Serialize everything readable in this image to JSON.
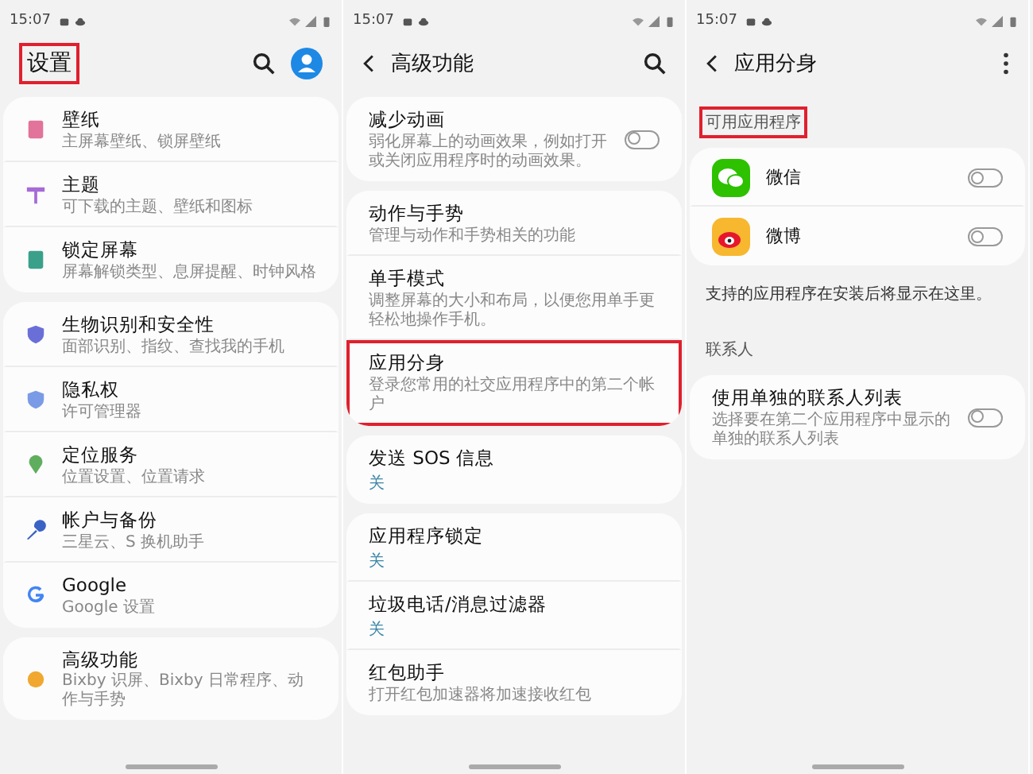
{
  "panels": [
    {
      "time": "15:07",
      "title": {
        "text": "设置",
        "highlighted": true
      },
      "back": false,
      "actions": [
        {
          "kind": "search"
        },
        {
          "kind": "avatar"
        }
      ],
      "groups": [
        {
          "kind": "card",
          "items": [
            {
              "kind": "entry",
              "title": "壁纸",
              "subtitle": "主屏幕壁纸、锁屏壁纸",
              "color": "#e2739a"
            },
            {
              "kind": "entry",
              "title": "主题",
              "subtitle": "可下载的主题、壁纸和图标",
              "color": "#a66bd6"
            },
            {
              "kind": "entry",
              "title": "锁定屏幕",
              "subtitle": "屏幕解锁类型、息屏提醒、时钟风格",
              "color": "#3aa08a"
            }
          ]
        },
        {
          "kind": "card",
          "items": [
            {
              "kind": "entry",
              "title": "生物识别和安全性",
              "subtitle": "面部识别、指纹、查找我的手机",
              "color": "#6a6fd8"
            },
            {
              "kind": "entry",
              "title": "隐私权",
              "subtitle": "许可管理器",
              "color": "#7a9be6"
            },
            {
              "kind": "entry",
              "title": "定位服务",
              "subtitle": "位置设置、位置请求",
              "color": "#5fae5f"
            },
            {
              "kind": "entry",
              "title": "帐户与备份",
              "subtitle": "三星云、S 换机助手",
              "color": "#3b62c5"
            },
            {
              "kind": "entry",
              "title": "Google",
              "subtitle": "Google 设置",
              "color": "#4285f4"
            }
          ]
        },
        {
          "kind": "card",
          "items": [
            {
              "kind": "entry",
              "title": "高级功能",
              "subtitle": "Bixby 识屏、Bixby 日常程序、动作与手势",
              "color": "#f0a830"
            }
          ]
        }
      ]
    },
    {
      "time": "15:07",
      "title": {
        "text": "高级功能",
        "highlighted": false
      },
      "back": true,
      "actions": [
        {
          "kind": "search"
        }
      ],
      "groups": [
        {
          "kind": "card",
          "items": [
            {
              "kind": "toggle",
              "title": "减少动画",
              "subtitle": "弱化屏幕上的动画效果，例如打开或关闭应用程序时的动画效果。",
              "on": false,
              "highlighted": false
            }
          ]
        },
        {
          "kind": "card",
          "items": [
            {
              "kind": "plain",
              "title": "动作与手势",
              "subtitle": "管理与动作和手势相关的功能",
              "highlighted": false
            },
            {
              "kind": "plain",
              "title": "单手模式",
              "subtitle": "调整屏幕的大小和布局，以便您用单手更轻松地操作手机。",
              "highlighted": false
            },
            {
              "kind": "plain",
              "title": "应用分身",
              "subtitle": "登录您常用的社交应用程序中的第二个帐户",
              "highlighted": true
            }
          ]
        },
        {
          "kind": "card",
          "items": [
            {
              "kind": "status",
              "title": "发送 SOS 信息",
              "status": "关",
              "highlighted": false
            }
          ]
        },
        {
          "kind": "card",
          "items": [
            {
              "kind": "status",
              "title": "应用程序锁定",
              "status": "关",
              "highlighted": false
            },
            {
              "kind": "status",
              "title": "垃圾电话/消息过滤器",
              "status": "关",
              "highlighted": false
            },
            {
              "kind": "plain",
              "title": "红包助手",
              "subtitle": "打开红包加速器将加速接收红包",
              "highlighted": false
            }
          ]
        }
      ]
    },
    {
      "time": "15:07",
      "title": {
        "text": "应用分身",
        "highlighted": false
      },
      "back": true,
      "actions": [
        {
          "kind": "more"
        }
      ],
      "groups": [
        {
          "kind": "header",
          "text": "可用应用程序",
          "highlighted": true
        },
        {
          "kind": "card",
          "items": [
            {
              "kind": "app",
              "title": "微信",
              "on": false
            },
            {
              "kind": "app",
              "title": "微博",
              "on": false
            }
          ]
        },
        {
          "kind": "note",
          "text": "支持的应用程序在安装后将显示在这里。"
        },
        {
          "kind": "header",
          "text": "联系人",
          "highlighted": false
        },
        {
          "kind": "card",
          "items": [
            {
              "kind": "toggle",
              "title": "使用单独的联系人列表",
              "subtitle": "选择要在第二个应用程序中显示的单独的联系人列表",
              "on": false
            }
          ]
        }
      ]
    }
  ]
}
